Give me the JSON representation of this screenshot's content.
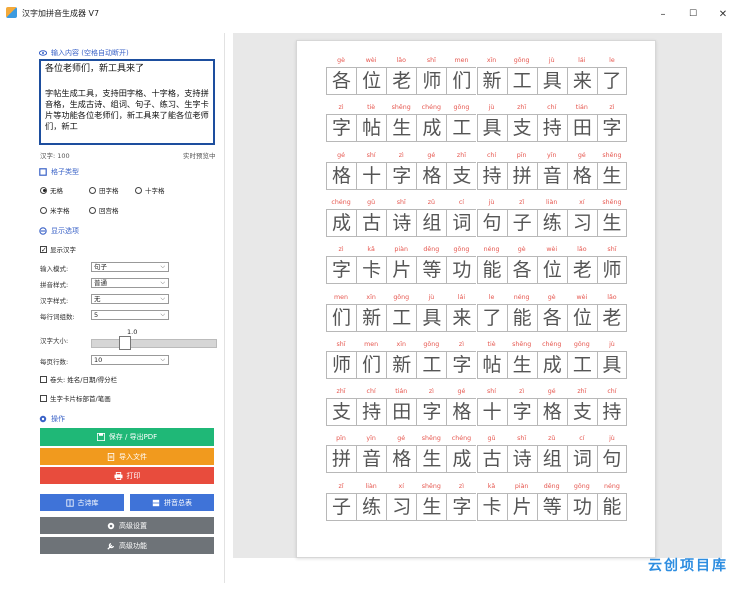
{
  "window": {
    "title": "汉字加拼音生成器 V7",
    "minimize": "–",
    "maximize": "☐",
    "close": "✕"
  },
  "input": {
    "section_label": "输入内容 (空格自动断开)",
    "line1": "各位老师们，新工具来了",
    "body": "字帖生成工具，支持田字格、十字格，支持拼音格，生成古诗、组词、句子、练习、生字卡片等功能各位老师们，新工具来了能各位老师们，新工",
    "count": "汉字: 100",
    "preview_label": "实时预览中"
  },
  "grid": {
    "section_label": "格子类型",
    "options": [
      {
        "label": "无格",
        "selected": true
      },
      {
        "label": "田字格",
        "selected": false
      },
      {
        "label": "十字格",
        "selected": false
      },
      {
        "label": "米字格",
        "selected": false
      },
      {
        "label": "回宫格",
        "selected": false
      }
    ]
  },
  "display": {
    "section_label": "显示选项",
    "show_hanzi": "显示汉字",
    "show_hanzi_checked": true,
    "fields": [
      {
        "label": "输入模式:",
        "value": "句子"
      },
      {
        "label": "拼音样式:",
        "value": "普通"
      },
      {
        "label": "汉字样式:",
        "value": "无"
      },
      {
        "label": "每行词组数:",
        "value": "5"
      }
    ],
    "font_size_label": "汉字大小:",
    "font_size_value": "1.0",
    "font_size_fraction": 0.33,
    "per_page_label": "每页行数:",
    "per_page_value": "10",
    "header_check": "卷头: 姓名/日期/得分栏",
    "card_check": "生字卡片标部首/笔画"
  },
  "actions": {
    "section_label": "操作",
    "save": "保存 / 导出PDF",
    "import": "导入文件",
    "print": "打印",
    "poems": "古诗库",
    "pinyin_table": "拼音总表",
    "advanced_settings": "高级设置",
    "advanced_functions": "高级功能"
  },
  "colors": {
    "accent": "#3a62c7",
    "save": "#1fb877",
    "import": "#f19a1e",
    "print": "#e84c3d",
    "blue_btn": "#3f73d8",
    "gray_btn": "#6e7378",
    "pinyin": "#e6574f"
  },
  "worksheet": {
    "rows": [
      {
        "py": [
          "gè",
          "wèi",
          "lǎo",
          "shī",
          "men",
          "xīn",
          "gōng",
          "jù",
          "lái",
          "le"
        ],
        "hz": [
          "各",
          "位",
          "老",
          "师",
          "们",
          "新",
          "工",
          "具",
          "来",
          "了"
        ]
      },
      {
        "py": [
          "zì",
          "tiè",
          "shēng",
          "chéng",
          "gōng",
          "jù",
          "zhī",
          "chí",
          "tián",
          "zì"
        ],
        "hz": [
          "字",
          "帖",
          "生",
          "成",
          "工",
          "具",
          "支",
          "持",
          "田",
          "字"
        ]
      },
      {
        "py": [
          "gé",
          "shí",
          "zì",
          "gé",
          "zhī",
          "chí",
          "pīn",
          "yīn",
          "gé",
          "shēng"
        ],
        "hz": [
          "格",
          "十",
          "字",
          "格",
          "支",
          "持",
          "拼",
          "音",
          "格",
          "生"
        ]
      },
      {
        "py": [
          "chéng",
          "gǔ",
          "shī",
          "zǔ",
          "cí",
          "jù",
          "zǐ",
          "liàn",
          "xí",
          "shēng"
        ],
        "hz": [
          "成",
          "古",
          "诗",
          "组",
          "词",
          "句",
          "子",
          "练",
          "习",
          "生"
        ]
      },
      {
        "py": [
          "zì",
          "kǎ",
          "piàn",
          "děng",
          "gōng",
          "néng",
          "gè",
          "wèi",
          "lǎo",
          "shī"
        ],
        "hz": [
          "字",
          "卡",
          "片",
          "等",
          "功",
          "能",
          "各",
          "位",
          "老",
          "师"
        ]
      },
      {
        "py": [
          "men",
          "xīn",
          "gōng",
          "jù",
          "lái",
          "le",
          "néng",
          "gè",
          "wèi",
          "lǎo"
        ],
        "hz": [
          "们",
          "新",
          "工",
          "具",
          "来",
          "了",
          "能",
          "各",
          "位",
          "老"
        ]
      },
      {
        "py": [
          "shī",
          "men",
          "xīn",
          "gōng",
          "zì",
          "tiè",
          "shēng",
          "chéng",
          "gōng",
          "jù"
        ],
        "hz": [
          "师",
          "们",
          "新",
          "工",
          "字",
          "帖",
          "生",
          "成",
          "工",
          "具"
        ]
      },
      {
        "py": [
          "zhī",
          "chí",
          "tián",
          "zì",
          "gé",
          "shí",
          "zì",
          "gé",
          "zhī",
          "chí"
        ],
        "hz": [
          "支",
          "持",
          "田",
          "字",
          "格",
          "十",
          "字",
          "格",
          "支",
          "持"
        ]
      },
      {
        "py": [
          "pīn",
          "yīn",
          "gé",
          "shēng",
          "chéng",
          "gǔ",
          "shī",
          "zǔ",
          "cí",
          "jù"
        ],
        "hz": [
          "拼",
          "音",
          "格",
          "生",
          "成",
          "古",
          "诗",
          "组",
          "词",
          "句"
        ]
      },
      {
        "py": [
          "zǐ",
          "liàn",
          "xí",
          "shēng",
          "zì",
          "kǎ",
          "piàn",
          "děng",
          "gōng",
          "néng"
        ],
        "hz": [
          "子",
          "练",
          "习",
          "生",
          "字",
          "卡",
          "片",
          "等",
          "功",
          "能"
        ]
      }
    ]
  },
  "watermark": "云创项目库"
}
